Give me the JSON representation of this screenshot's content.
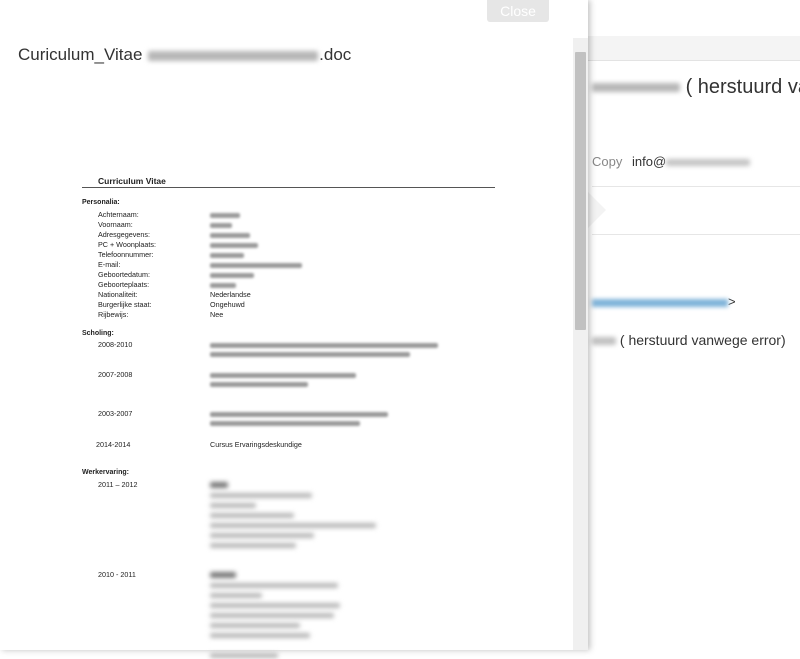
{
  "email": {
    "subject_suffix": "( herstuurd va",
    "copy_label": "Copy",
    "copy_value_prefix": "info@",
    "from_suffix": ">",
    "body_text": "( herstuurd vanwege error)"
  },
  "viewer": {
    "close_label": "Close",
    "filename_prefix": "Curiculum_Vitae",
    "filename_suffix": ".doc"
  },
  "cv": {
    "heading": "Curriculum Vitae",
    "personalia_title": "Personalia:",
    "personal": [
      {
        "label": "Achternaam:",
        "value": ""
      },
      {
        "label": "Voornaam:",
        "value": ""
      },
      {
        "label": "Adresgegevens:",
        "value": ""
      },
      {
        "label": "PC + Woonplaats:",
        "value": ""
      },
      {
        "label": "Telefoonnummer:",
        "value": ""
      },
      {
        "label": "E-mail:",
        "value": ""
      },
      {
        "label": "Geboortedatum:",
        "value": ""
      },
      {
        "label": "Geboorteplaats:",
        "value": ""
      },
      {
        "label": "Nationaliteit:",
        "value": "Nederlandse"
      },
      {
        "label": "Burgerlijke staat:",
        "value": "Ongehuwd"
      },
      {
        "label": "Rijbewijs:",
        "value": "Nee"
      }
    ],
    "scholing_title": "Scholing:",
    "education": [
      {
        "years": "2008-2010",
        "text": ""
      },
      {
        "years": "2007-2008",
        "text": ""
      },
      {
        "years": "2003-2007",
        "text": ""
      },
      {
        "years": "2014-2014",
        "text": "Cursus Ervaringsdeskundige"
      }
    ],
    "werk_title": "Werkervaring:",
    "work": [
      {
        "years": "2011 – 2012"
      },
      {
        "years": "2010 - 2011"
      }
    ]
  }
}
